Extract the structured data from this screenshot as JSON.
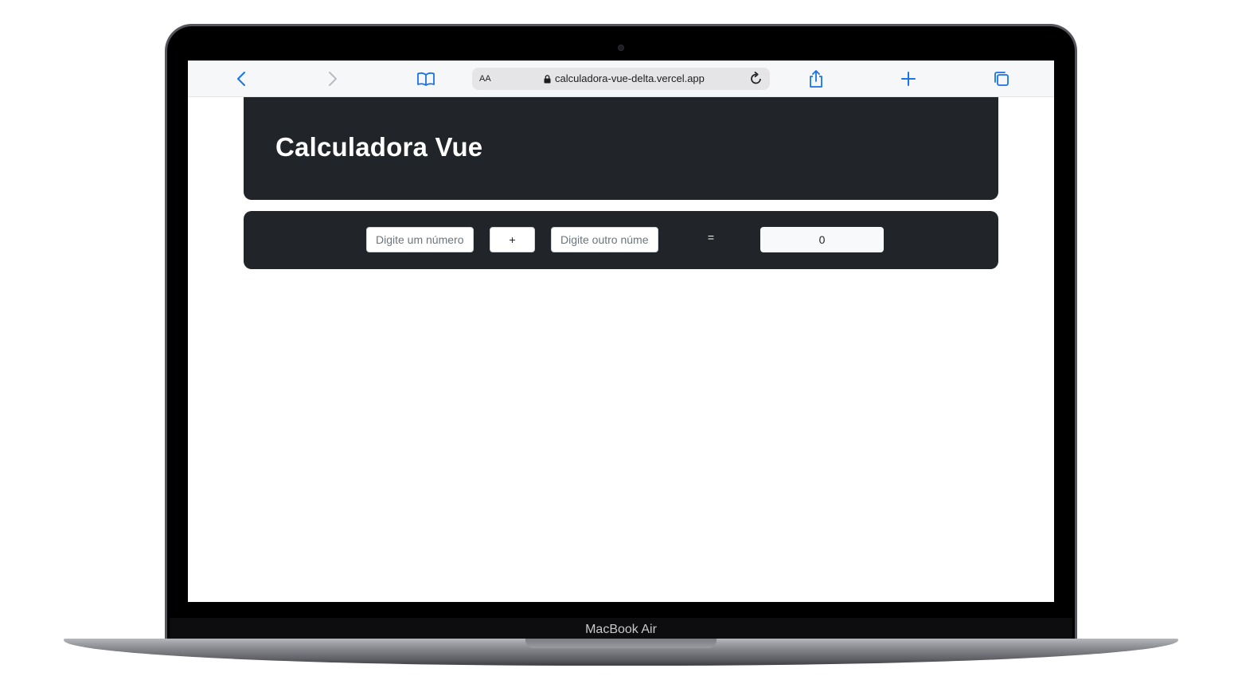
{
  "device": {
    "model_label": "MacBook Air"
  },
  "browser": {
    "text_size_label": "AA",
    "url": "calculadora-vue-delta.vercel.app",
    "icons": {
      "back": "chevron-left-icon",
      "forward": "chevron-right-icon",
      "bookmarks": "book-icon",
      "lock": "lock-icon",
      "reload": "reload-icon",
      "share": "share-icon",
      "new_tab": "plus-icon",
      "tabs": "tabs-icon"
    },
    "accent_color": "#1a73e8"
  },
  "page": {
    "title": "Calculadora Vue",
    "calculator": {
      "first_input": {
        "value": "",
        "placeholder": "Digite um número"
      },
      "operator": "+",
      "second_input": {
        "value": "",
        "placeholder": "Digite outro número"
      },
      "equals": "=",
      "result": "0"
    },
    "colors": {
      "card_bg": "#212529",
      "result_bg": "#f8f9fa"
    }
  }
}
